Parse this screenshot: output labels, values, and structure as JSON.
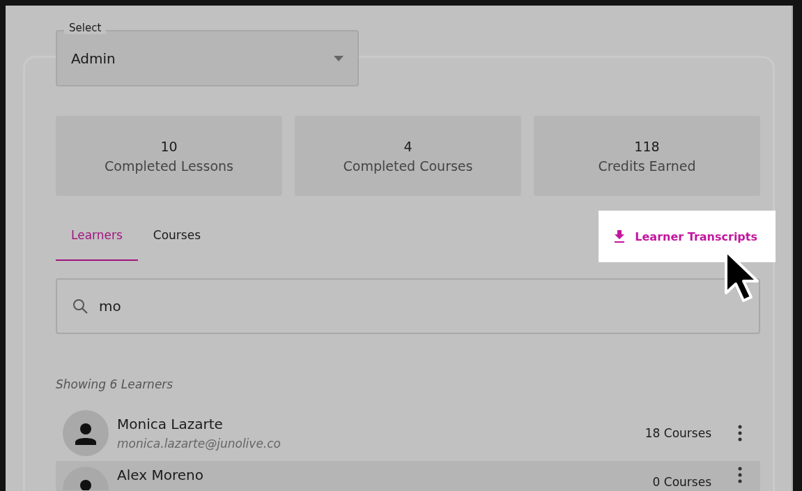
{
  "role_select": {
    "label": "Select",
    "value": "Admin"
  },
  "stats": [
    {
      "value": "10",
      "label": "Completed Lessons"
    },
    {
      "value": "4",
      "label": "Completed Courses"
    },
    {
      "value": "118",
      "label": "Credits Earned"
    }
  ],
  "tabs": [
    {
      "label": "Learners",
      "selected": true
    },
    {
      "label": "Courses",
      "selected": false
    }
  ],
  "transcripts_button": {
    "label": "Learner Transcripts"
  },
  "search": {
    "value": "mo"
  },
  "result_count": "Showing 6 Learners",
  "learners": [
    {
      "name": "Monica Lazarte",
      "email": "monica.lazarte@junolive.co",
      "courses": "18 Courses",
      "selected": false
    },
    {
      "name": "Alex Moreno",
      "courses": "0 Courses",
      "selected": true
    }
  ]
}
